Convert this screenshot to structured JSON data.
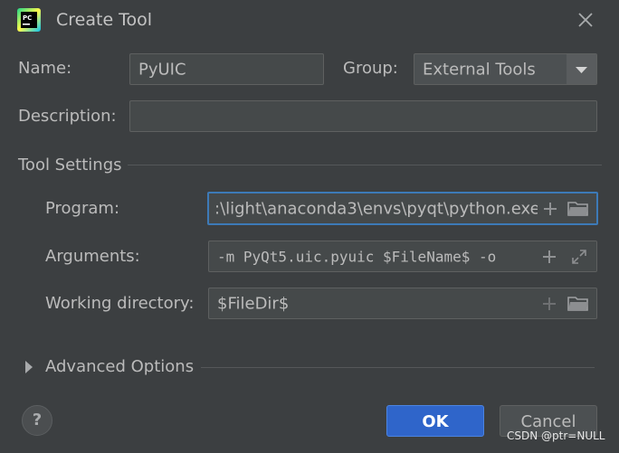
{
  "dialog": {
    "title": "Create Tool"
  },
  "form": {
    "name_label": "Name:",
    "name_value": "PyUIC",
    "group_label": "Group:",
    "group_value": "External Tools",
    "description_label": "Description:",
    "description_value": ""
  },
  "tool_settings": {
    "section_label": "Tool Settings",
    "program_label": "Program:",
    "program_value": ":\\light\\anaconda3\\envs\\pyqt\\python.exe",
    "arguments_label": "Arguments:",
    "arguments_value": "-m PyQt5.uic.pyuic $FileName$ -o",
    "working_dir_label": "Working directory:",
    "working_dir_value": "$FileDir$"
  },
  "advanced": {
    "label": "Advanced Options"
  },
  "buttons": {
    "help": "?",
    "ok": "OK",
    "cancel": "Cancel"
  },
  "watermark": "CSDN @ptr=NULL",
  "icons": [
    "pycharm-logo-icon",
    "close-icon",
    "dropdown-arrow-icon",
    "plus-icon",
    "folder-icon",
    "expand-icon",
    "triangle-right-icon"
  ],
  "colors": {
    "background": "#3c3f41",
    "field": "#45494a",
    "focus": "#3d7ab7",
    "ok_button": "#2f65ca"
  }
}
